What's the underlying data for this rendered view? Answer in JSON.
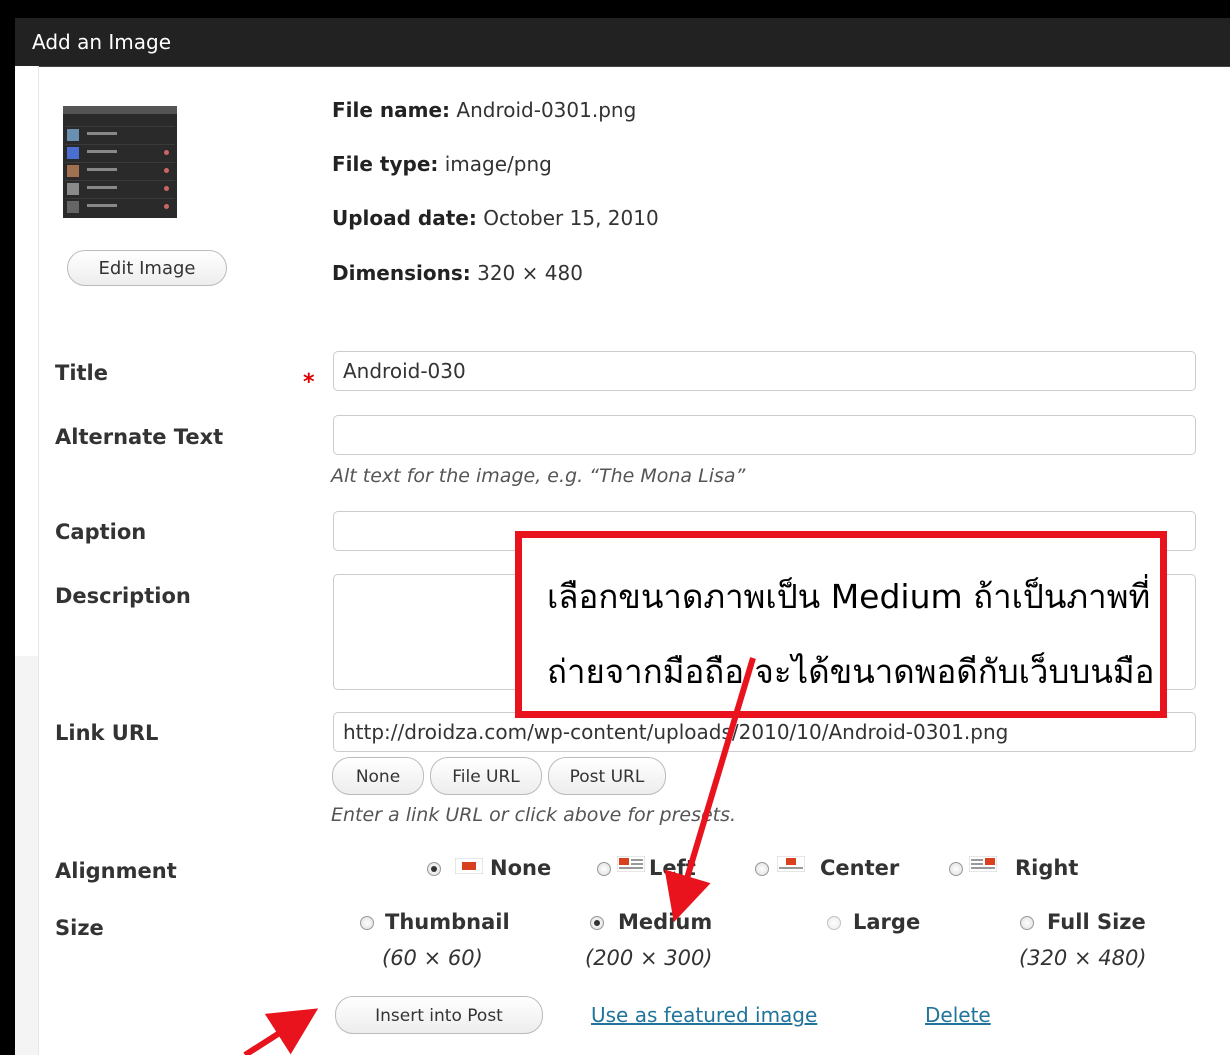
{
  "title": "Add an Image",
  "edit_image_label": "Edit Image",
  "file_info": {
    "file_name_label": "File name:",
    "file_name": "Android-0301.png",
    "file_type_label": "File type:",
    "file_type": "image/png",
    "upload_date_label": "Upload date:",
    "upload_date": "October 15, 2010",
    "dimensions_label": "Dimensions:",
    "dimensions": "320 × 480"
  },
  "fields": {
    "title_label": "Title",
    "title_value": "Android-030",
    "required_mark": "*",
    "alt_label": "Alternate Text",
    "alt_value": "",
    "alt_hint": "Alt text for the image, e.g. “The Mona Lisa”",
    "caption_label": "Caption",
    "caption_value": "",
    "description_label": "Description",
    "description_value": "",
    "link_label": "Link URL",
    "link_value": "http://droidza.com/wp-content/uploads/2010/10/Android-0301.png",
    "link_hint": "Enter a link URL or click above for presets."
  },
  "link_buttons": [
    "None",
    "File URL",
    "Post URL"
  ],
  "alignment": {
    "label": "Alignment",
    "options": [
      "None",
      "Left",
      "Center",
      "Right"
    ],
    "selected": "None"
  },
  "size": {
    "label": "Size",
    "options": [
      {
        "name": "Thumbnail",
        "dims": "(60 × 60)"
      },
      {
        "name": "Medium",
        "dims": "(200 × 300)"
      },
      {
        "name": "Large",
        "dims": ""
      },
      {
        "name": "Full Size",
        "dims": "(320 × 480)"
      }
    ],
    "selected": "Medium"
  },
  "actions": {
    "insert": "Insert into Post",
    "featured": "Use as featured image",
    "delete": "Delete"
  },
  "callout": {
    "line1": "เลือกขนาดภาพเป็น Medium ถ้าเป็นภาพที่",
    "line2": "ถ่ายจากมือถือ จะได้ขนาดพอดีกับเว็บบนมือ"
  },
  "colors": {
    "callout": "#e8131c",
    "link": "#21759b",
    "titlebar": "#222222"
  }
}
